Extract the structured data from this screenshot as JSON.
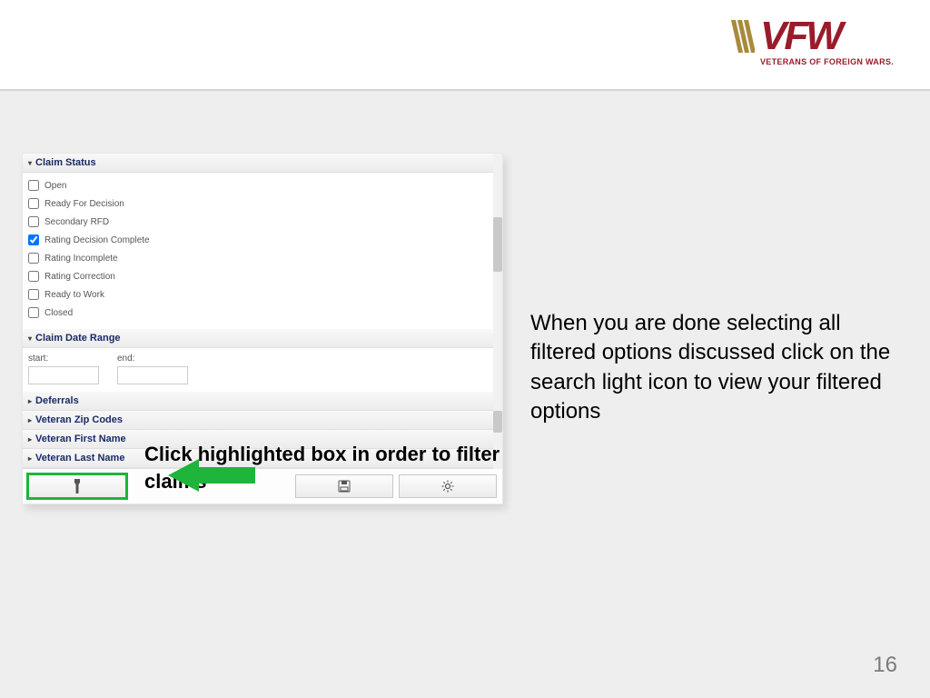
{
  "logo": {
    "letters": "VFW",
    "subtitle": "VETERANS OF FOREIGN WARS."
  },
  "claim_status": {
    "header": "Claim Status",
    "options": [
      {
        "label": "Open",
        "checked": false
      },
      {
        "label": "Ready For Decision",
        "checked": false
      },
      {
        "label": "Secondary RFD",
        "checked": false
      },
      {
        "label": "Rating Decision Complete",
        "checked": true
      },
      {
        "label": "Rating Incomplete",
        "checked": false
      },
      {
        "label": "Rating Correction",
        "checked": false
      },
      {
        "label": "Ready to Work",
        "checked": false
      },
      {
        "label": "Closed",
        "checked": false
      }
    ]
  },
  "claim_date_range": {
    "header": "Claim Date Range",
    "start_label": "start:",
    "end_label": "end:",
    "start_value": "",
    "end_value": ""
  },
  "collapsed_sections": {
    "deferrals": "Deferrals",
    "veteran_zip": "Veteran Zip Codes",
    "veteran_first": "Veteran First Name",
    "veteran_last": "Veteran Last Name"
  },
  "toolbar": {
    "search_icon": "flashlight",
    "save_icon": "save",
    "gear_icon": "gear"
  },
  "overlay_text": "Click highlighted box in order to filter claims",
  "instruction": "When you are done selecting all filtered options discussed click on the search light icon to view your filtered options",
  "page_number": "16"
}
